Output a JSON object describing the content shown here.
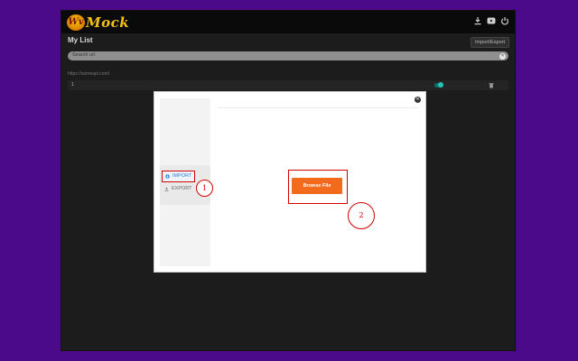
{
  "app": {
    "logo_mark": "Wv",
    "logo_word": "Mock",
    "top_icons": [
      "download-icon",
      "youtube-icon",
      "power-icon"
    ]
  },
  "list": {
    "title": "My List",
    "import_export_label": "Import/Export",
    "search_placeholder": "Search url",
    "url_label": "https://someapi.com/",
    "rows": [
      {
        "number": "1",
        "enabled": true
      }
    ]
  },
  "modal": {
    "menu": {
      "import_label": "IMPORT",
      "export_label": "EXPORT"
    },
    "browse_label": "Browse File"
  },
  "annotations": {
    "callout_1": "1",
    "callout_2": "2",
    "highlight_color": "#d40000"
  },
  "colors": {
    "background": "#4a0a8a",
    "accent_orange": "#f26b1d",
    "toggle_teal": "#29c2b5",
    "import_blue": "#2f7fd6"
  }
}
